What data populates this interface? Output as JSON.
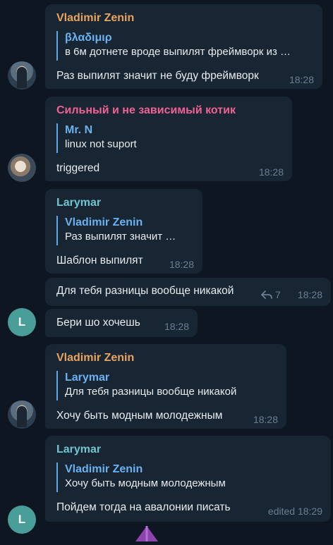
{
  "messages": [
    {
      "sender": "Vladimir Zenin",
      "reply_name": "βλαδιμιρ",
      "reply_text": "в 6м дотнете вроде выпилят фреймворк из …",
      "text": "Раз выпилят значит не буду фреймворк",
      "time": "18:28"
    },
    {
      "sender": "Сильный и не зависимый котик",
      "reply_name": "Mr. N",
      "reply_text": "linux not suport",
      "text": "triggered",
      "time": "18:28"
    },
    {
      "sender": "Larymar",
      "reply_name": "Vladimir Zenin",
      "reply_text": "Раз выпилят значит …",
      "text": "Шаблон выпилят",
      "time": "18:28"
    },
    {
      "text": "Для тебя разницы вообще никакой",
      "replies": "7",
      "time": "18:28"
    },
    {
      "text": "Бери шо хочешь",
      "time": "18:28"
    },
    {
      "sender": "Vladimir Zenin",
      "reply_name": "Larymar",
      "reply_text": "Для тебя разницы вообще никакой",
      "text": "Хочу быть модным молодежным",
      "time": "18:28"
    },
    {
      "sender": "Larymar",
      "reply_name": "Vladimir Zenin",
      "reply_text": "Хочу быть модным молодежным",
      "text": "Пойдем тогда на авалонии писать",
      "time": "edited 18:29"
    }
  ],
  "avatars": {
    "larymar_letter": "L"
  },
  "colors": {
    "background": "#0e1621",
    "bubble": "#182533",
    "sender_vladimir": "#e9a45f",
    "sender_kotik": "#f06292",
    "sender_larymar": "#6fc5d0",
    "reply_name": "#6ab2f2",
    "meta": "#6d7f8f"
  }
}
